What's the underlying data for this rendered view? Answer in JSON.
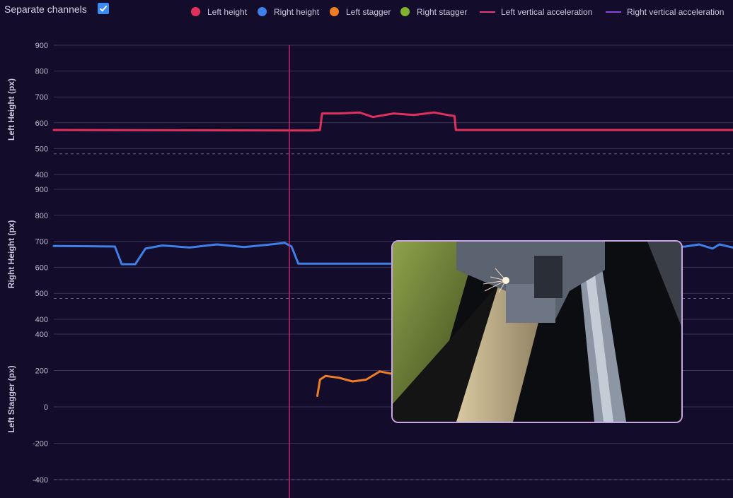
{
  "toolbar": {
    "separate_channels_label": "Separate channels",
    "separate_channels_checked": true
  },
  "legend": [
    {
      "label": "Left height",
      "color": "#e0305e",
      "marker": "dot"
    },
    {
      "label": "Right height",
      "color": "#3f7fe8",
      "marker": "dot"
    },
    {
      "label": "Left stagger",
      "color": "#ef7d26",
      "marker": "dot"
    },
    {
      "label": "Right stagger",
      "color": "#7fb02e",
      "marker": "dot"
    },
    {
      "label": "Left vertical acceleration",
      "color": "#e23a7a",
      "marker": "line"
    },
    {
      "label": "Right vertical acceleration",
      "color": "#8b46e0",
      "marker": "line"
    }
  ],
  "colors": {
    "background": "#130c2a",
    "cursor": "#c0246a",
    "video_border": "#c7a6e6"
  },
  "video_overlay": {
    "icon": "camera-feed-thumbnail"
  },
  "chart_data": [
    {
      "type": "line",
      "ylabel": "Left Height (px)",
      "yticks": [
        "900",
        "800",
        "700",
        "600",
        "500",
        "400"
      ],
      "ylim": [
        400,
        900
      ],
      "grid": true,
      "threshold": 480,
      "series": [
        {
          "name": "Left height",
          "color": "#e0305e",
          "x": [
            0,
            0.38,
            0.392,
            0.395,
            0.42,
            0.45,
            0.47,
            0.5,
            0.53,
            0.56,
            0.58,
            0.59,
            0.592,
            0.7,
            0.85,
            1.0
          ],
          "y": [
            572,
            570,
            572,
            636,
            636,
            640,
            622,
            636,
            630,
            640,
            630,
            626,
            572,
            572,
            572,
            572
          ]
        }
      ]
    },
    {
      "type": "line",
      "ylabel": "Right Height (px)",
      "yticks": [
        "900",
        "800",
        "700",
        "600",
        "500",
        "400"
      ],
      "ylim": [
        400,
        900
      ],
      "grid": true,
      "threshold": 480,
      "series": [
        {
          "name": "Right height",
          "color": "#3f7fe8",
          "x": [
            0,
            0.09,
            0.1,
            0.11,
            0.12,
            0.135,
            0.16,
            0.2,
            0.24,
            0.28,
            0.32,
            0.34,
            0.35,
            0.36,
            0.45,
            0.53,
            0.93,
            0.95,
            0.97,
            0.98,
            1.0
          ],
          "y": [
            682,
            680,
            612,
            612,
            612,
            672,
            684,
            676,
            688,
            678,
            688,
            694,
            680,
            614,
            614,
            614,
            680,
            688,
            672,
            688,
            676
          ]
        }
      ]
    },
    {
      "type": "line",
      "ylabel": "Left Stagger (px)",
      "yticks": [
        "400",
        "200",
        "0",
        "-200",
        "-400"
      ],
      "ylim": [
        -400,
        400
      ],
      "grid": true,
      "threshold": -400,
      "series": [
        {
          "name": "Left stagger",
          "color": "#ef7d26",
          "x": [
            0.388,
            0.392,
            0.4,
            0.42,
            0.44,
            0.46,
            0.48,
            0.5,
            0.52,
            0.53
          ],
          "y": [
            60,
            150,
            170,
            160,
            140,
            150,
            195,
            180,
            190,
            185
          ]
        }
      ]
    }
  ]
}
